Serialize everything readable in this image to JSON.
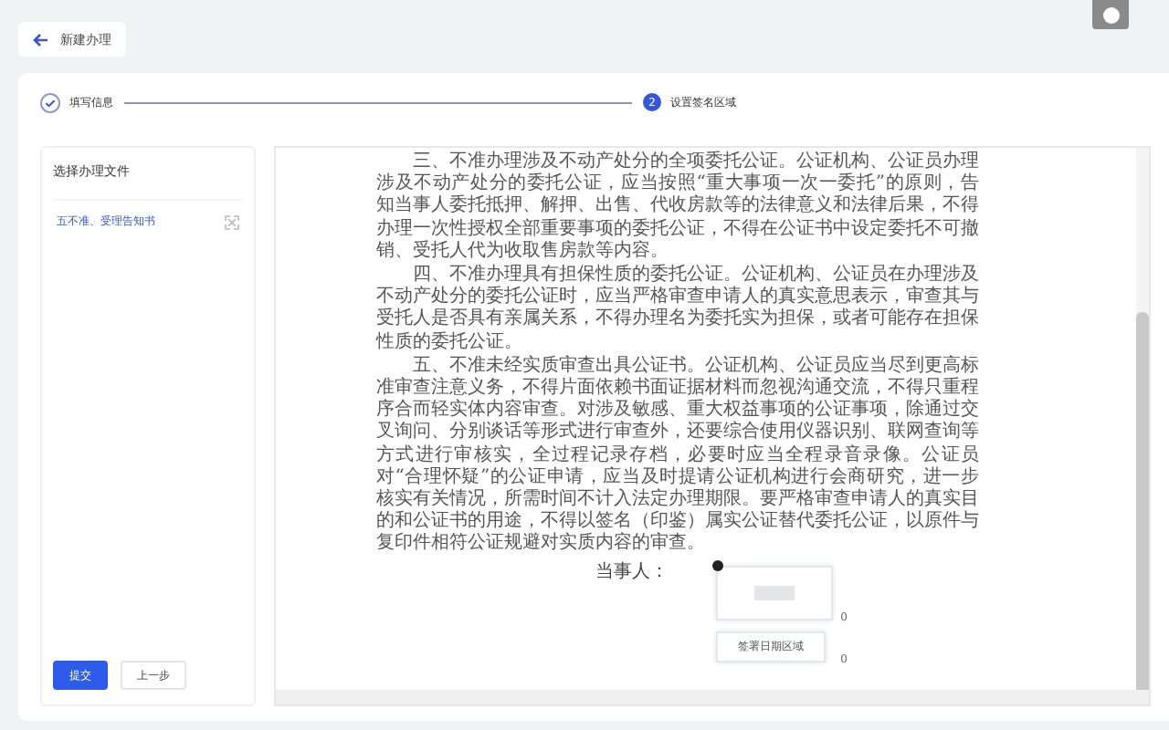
{
  "header": {
    "back_label": "新建办理"
  },
  "steps": [
    {
      "label": "填写信息",
      "done": true
    },
    {
      "label": "设置签名区域",
      "number": "2",
      "done": false
    }
  ],
  "file_panel": {
    "title": "选择办理文件",
    "files": [
      {
        "name": "五不准、受理告知书",
        "selected": true
      }
    ]
  },
  "buttons": [
    {
      "label": "提交",
      "kind": "primary"
    },
    {
      "label": "上一步",
      "kind": "secondary"
    }
  ],
  "document": {
    "paragraphs": [
      "三、不准办理涉及不动产处分的全项委托公证。公证机构、公证员办理涉及不动产处分的委托公证，应当按照“重大事项一次一委托”的原则，告知当事人委托抵押、解押、出售、代收房款等的法律意义和法律后果，不得办理一次性授权全部重要事项的委托公证，不得在公证书中设定委托不可撤销、受托人代为收取售房款等内容。",
      "四、不准办理具有担保性质的委托公证。公证机构、公证员在办理涉及不动产处分的委托公证时，应当严格审查申请人的真实意思表示，审查其与受托人是否具有亲属关系，不得办理名为委托实为担保，或者可能存在担保性质的委托公证。",
      "五、不准未经实质审查出具公证书。公证机构、公证员应当尽到更高标准审查注意义务，不得片面依赖书面证据材料而忽视沟通交流，不得只重程序合而轻实体内容审查。对涉及敏感、重大权益事项的公证事项，除通过交叉询问、分别谈话等形式进行审查外，还要综合使用仪器识别、联网查询等方式进行审核实，全过程记录存档，必要时应当全程录音录像。公证员对“合理怀疑”的公证申请，应当及时提请公证机构进行会商研究，进一步核实有关情况，所需时间不计入法定办理期限。要严格审查申请人的真实目的和公证书的用途，不得以签名（印鉴）属实公证替代委托公证，以原件与复印件相符公证规避对实质内容的审查。"
    ],
    "signer_label": "当事人：",
    "sign_fields": [
      {
        "kind": "signature",
        "index": "0"
      },
      {
        "kind": "date",
        "label": "签署日期区域",
        "index": "0"
      }
    ]
  }
}
